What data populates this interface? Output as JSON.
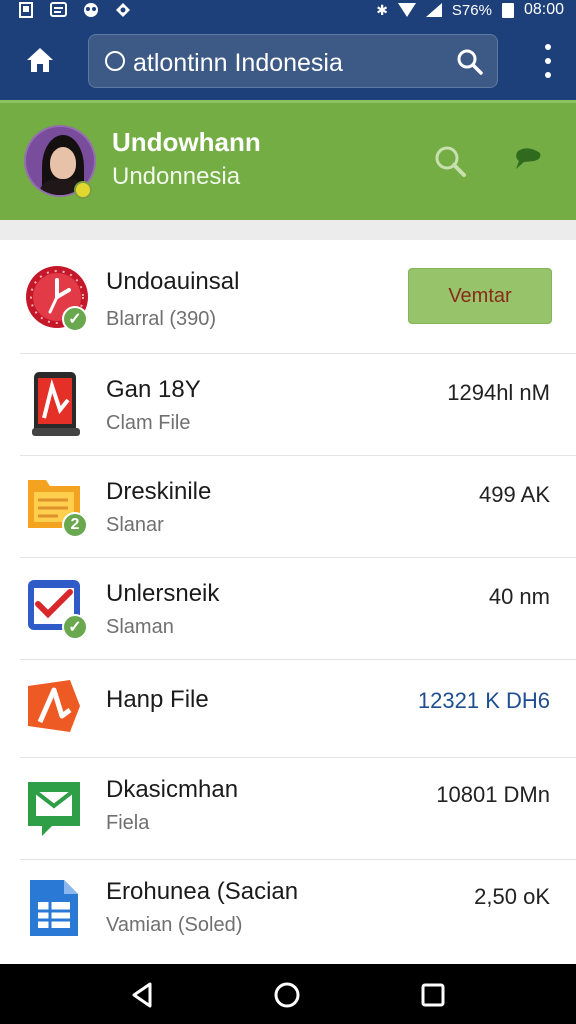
{
  "status_bar": {
    "battery": "S76%",
    "time": "08:00"
  },
  "app_bar": {
    "home_icon": "home-icon",
    "search_text": "atlontinn Indonesia",
    "search_icon": "search-icon",
    "more_icon": "more-vertical-icon"
  },
  "profile": {
    "name": "Undowhann",
    "subtitle": "Undonnesia",
    "search_icon": "search-icon",
    "chat_icon": "chat-icon",
    "colors": {
      "header_green": "#73ad44",
      "bar_blue": "#1d3f7a"
    }
  },
  "list": {
    "items": [
      {
        "title": "Undoauinsal",
        "subtitle": "Blarral (390)",
        "action_label": "Vemtar",
        "icon": "clock-app-icon",
        "badge": ""
      },
      {
        "title": "Gan 18Y",
        "subtitle": "Clam File",
        "meta": "1294hl nM",
        "icon": "pdf-phone-icon"
      },
      {
        "title": "Dreskinile",
        "subtitle": "Slanar",
        "meta": "499 AK",
        "icon": "notes-folder-icon",
        "badge": "2"
      },
      {
        "title": "Unlersneik",
        "subtitle": "Slaman",
        "meta": "40 nm",
        "icon": "checkmark-app-icon",
        "badge": ""
      },
      {
        "title": "Hanp File",
        "subtitle": "",
        "meta": "12321 K DH6",
        "icon": "acrobat-icon"
      },
      {
        "title": "Dkasicmhan",
        "subtitle": "Fiela",
        "meta": "10801 DMn",
        "icon": "mail-app-icon"
      },
      {
        "title": "Erohunea (Sacian",
        "subtitle": "Vamian (Soled)",
        "meta": "2,50 oK",
        "icon": "sheets-app-icon"
      }
    ]
  },
  "nav_bar": {
    "back_icon": "back-icon",
    "home_icon": "home-circle-icon",
    "recents_icon": "recents-icon"
  }
}
